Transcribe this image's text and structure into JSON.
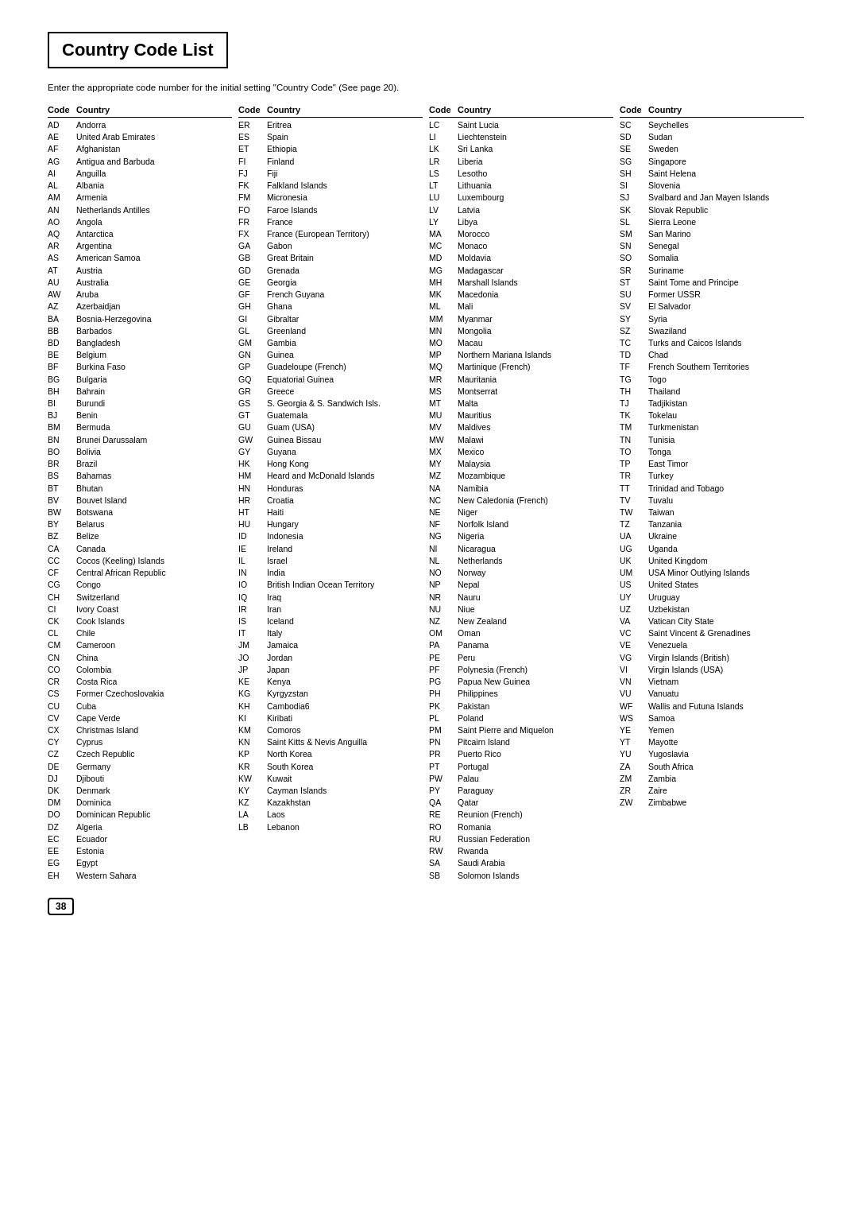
{
  "title": "Country Code List",
  "intro": "Enter the appropriate code number for the initial setting \"Country Code\" (See page 20).",
  "header": {
    "code": "Code",
    "country": "Country"
  },
  "page_number": "38",
  "columns": [
    {
      "entries": [
        {
          "code": "AD",
          "country": "Andorra"
        },
        {
          "code": "AE",
          "country": "United Arab Emirates"
        },
        {
          "code": "AF",
          "country": "Afghanistan"
        },
        {
          "code": "AG",
          "country": "Antigua and Barbuda"
        },
        {
          "code": "AI",
          "country": "Anguilla"
        },
        {
          "code": "AL",
          "country": "Albania"
        },
        {
          "code": "AM",
          "country": "Armenia"
        },
        {
          "code": "AN",
          "country": "Netherlands Antilles"
        },
        {
          "code": "AO",
          "country": "Angola"
        },
        {
          "code": "AQ",
          "country": "Antarctica"
        },
        {
          "code": "AR",
          "country": "Argentina"
        },
        {
          "code": "AS",
          "country": "American Samoa"
        },
        {
          "code": "AT",
          "country": "Austria"
        },
        {
          "code": "AU",
          "country": "Australia"
        },
        {
          "code": "AW",
          "country": "Aruba"
        },
        {
          "code": "AZ",
          "country": "Azerbaidjan"
        },
        {
          "code": "BA",
          "country": "Bosnia-Herzegovina"
        },
        {
          "code": "BB",
          "country": "Barbados"
        },
        {
          "code": "BD",
          "country": "Bangladesh"
        },
        {
          "code": "BE",
          "country": "Belgium"
        },
        {
          "code": "BF",
          "country": "Burkina Faso"
        },
        {
          "code": "BG",
          "country": "Bulgaria"
        },
        {
          "code": "BH",
          "country": "Bahrain"
        },
        {
          "code": "BI",
          "country": "Burundi"
        },
        {
          "code": "BJ",
          "country": "Benin"
        },
        {
          "code": "BM",
          "country": "Bermuda"
        },
        {
          "code": "BN",
          "country": "Brunei Darussalam"
        },
        {
          "code": "BO",
          "country": "Bolivia"
        },
        {
          "code": "BR",
          "country": "Brazil"
        },
        {
          "code": "BS",
          "country": "Bahamas"
        },
        {
          "code": "BT",
          "country": "Bhutan"
        },
        {
          "code": "BV",
          "country": "Bouvet Island"
        },
        {
          "code": "BW",
          "country": "Botswana"
        },
        {
          "code": "BY",
          "country": "Belarus"
        },
        {
          "code": "BZ",
          "country": "Belize"
        },
        {
          "code": "CA",
          "country": "Canada"
        },
        {
          "code": "CC",
          "country": "Cocos (Keeling) Islands"
        },
        {
          "code": "CF",
          "country": "Central African Republic"
        },
        {
          "code": "CG",
          "country": "Congo"
        },
        {
          "code": "CH",
          "country": "Switzerland"
        },
        {
          "code": "CI",
          "country": "Ivory Coast"
        },
        {
          "code": "CK",
          "country": "Cook Islands"
        },
        {
          "code": "CL",
          "country": "Chile"
        },
        {
          "code": "CM",
          "country": "Cameroon"
        },
        {
          "code": "CN",
          "country": "China"
        },
        {
          "code": "CO",
          "country": "Colombia"
        },
        {
          "code": "CR",
          "country": "Costa Rica"
        },
        {
          "code": "CS",
          "country": "Former Czechoslovakia"
        },
        {
          "code": "CU",
          "country": "Cuba"
        },
        {
          "code": "CV",
          "country": "Cape Verde"
        },
        {
          "code": "CX",
          "country": "Christmas Island"
        },
        {
          "code": "CY",
          "country": "Cyprus"
        },
        {
          "code": "CZ",
          "country": "Czech Republic"
        },
        {
          "code": "DE",
          "country": "Germany"
        },
        {
          "code": "DJ",
          "country": "Djibouti"
        },
        {
          "code": "DK",
          "country": "Denmark"
        },
        {
          "code": "DM",
          "country": "Dominica"
        },
        {
          "code": "DO",
          "country": "Dominican Republic"
        },
        {
          "code": "DZ",
          "country": "Algeria"
        },
        {
          "code": "EC",
          "country": "Ecuador"
        },
        {
          "code": "EE",
          "country": "Estonia"
        },
        {
          "code": "EG",
          "country": "Egypt"
        },
        {
          "code": "EH",
          "country": "Western Sahara"
        }
      ]
    },
    {
      "entries": [
        {
          "code": "ER",
          "country": "Eritrea"
        },
        {
          "code": "ES",
          "country": "Spain"
        },
        {
          "code": "ET",
          "country": "Ethiopia"
        },
        {
          "code": "FI",
          "country": "Finland"
        },
        {
          "code": "FJ",
          "country": "Fiji"
        },
        {
          "code": "FK",
          "country": "Falkland Islands"
        },
        {
          "code": "FM",
          "country": "Micronesia"
        },
        {
          "code": "FO",
          "country": "Faroe Islands"
        },
        {
          "code": "FR",
          "country": "France"
        },
        {
          "code": "FX",
          "country": "France (European Territory)"
        },
        {
          "code": "GA",
          "country": "Gabon"
        },
        {
          "code": "GB",
          "country": "Great Britain"
        },
        {
          "code": "GD",
          "country": "Grenada"
        },
        {
          "code": "GE",
          "country": "Georgia"
        },
        {
          "code": "GF",
          "country": "French Guyana"
        },
        {
          "code": "GH",
          "country": "Ghana"
        },
        {
          "code": "GI",
          "country": "Gibraltar"
        },
        {
          "code": "GL",
          "country": "Greenland"
        },
        {
          "code": "GM",
          "country": "Gambia"
        },
        {
          "code": "GN",
          "country": "Guinea"
        },
        {
          "code": "GP",
          "country": "Guadeloupe (French)"
        },
        {
          "code": "GQ",
          "country": "Equatorial Guinea"
        },
        {
          "code": "GR",
          "country": "Greece"
        },
        {
          "code": "GS",
          "country": "S. Georgia & S. Sandwich Isls."
        },
        {
          "code": "GT",
          "country": "Guatemala"
        },
        {
          "code": "GU",
          "country": "Guam (USA)"
        },
        {
          "code": "GW",
          "country": "Guinea Bissau"
        },
        {
          "code": "GY",
          "country": "Guyana"
        },
        {
          "code": "HK",
          "country": "Hong Kong"
        },
        {
          "code": "HM",
          "country": "Heard and McDonald Islands"
        },
        {
          "code": "HN",
          "country": "Honduras"
        },
        {
          "code": "HR",
          "country": "Croatia"
        },
        {
          "code": "HT",
          "country": "Haiti"
        },
        {
          "code": "HU",
          "country": "Hungary"
        },
        {
          "code": "ID",
          "country": "Indonesia"
        },
        {
          "code": "IE",
          "country": "Ireland"
        },
        {
          "code": "IL",
          "country": "Israel"
        },
        {
          "code": "IN",
          "country": "India"
        },
        {
          "code": "IO",
          "country": "British Indian Ocean Territory"
        },
        {
          "code": "IQ",
          "country": "Iraq"
        },
        {
          "code": "IR",
          "country": "Iran"
        },
        {
          "code": "IS",
          "country": "Iceland"
        },
        {
          "code": "IT",
          "country": "Italy"
        },
        {
          "code": "JM",
          "country": "Jamaica"
        },
        {
          "code": "JO",
          "country": "Jordan"
        },
        {
          "code": "JP",
          "country": "Japan"
        },
        {
          "code": "KE",
          "country": "Kenya"
        },
        {
          "code": "KG",
          "country": "Kyrgyzstan"
        },
        {
          "code": "KH",
          "country": "Cambodia6"
        },
        {
          "code": "KI",
          "country": "Kiribati"
        },
        {
          "code": "KM",
          "country": "Comoros"
        },
        {
          "code": "KN",
          "country": "Saint Kitts & Nevis Anguilla"
        },
        {
          "code": "KP",
          "country": "North Korea"
        },
        {
          "code": "KR",
          "country": "South Korea"
        },
        {
          "code": "KW",
          "country": "Kuwait"
        },
        {
          "code": "KY",
          "country": "Cayman Islands"
        },
        {
          "code": "KZ",
          "country": "Kazakhstan"
        },
        {
          "code": "LA",
          "country": "Laos"
        },
        {
          "code": "LB",
          "country": "Lebanon"
        }
      ]
    },
    {
      "entries": [
        {
          "code": "LC",
          "country": "Saint Lucia"
        },
        {
          "code": "LI",
          "country": "Liechtenstein"
        },
        {
          "code": "LK",
          "country": "Sri Lanka"
        },
        {
          "code": "LR",
          "country": "Liberia"
        },
        {
          "code": "LS",
          "country": "Lesotho"
        },
        {
          "code": "LT",
          "country": "Lithuania"
        },
        {
          "code": "LU",
          "country": "Luxembourg"
        },
        {
          "code": "LV",
          "country": "Latvia"
        },
        {
          "code": "LY",
          "country": "Libya"
        },
        {
          "code": "MA",
          "country": "Morocco"
        },
        {
          "code": "MC",
          "country": "Monaco"
        },
        {
          "code": "MD",
          "country": "Moldavia"
        },
        {
          "code": "MG",
          "country": "Madagascar"
        },
        {
          "code": "MH",
          "country": "Marshall Islands"
        },
        {
          "code": "MK",
          "country": "Macedonia"
        },
        {
          "code": "ML",
          "country": "Mali"
        },
        {
          "code": "MM",
          "country": "Myanmar"
        },
        {
          "code": "MN",
          "country": "Mongolia"
        },
        {
          "code": "MO",
          "country": "Macau"
        },
        {
          "code": "MP",
          "country": "Northern Mariana Islands"
        },
        {
          "code": "MQ",
          "country": "Martinique (French)"
        },
        {
          "code": "MR",
          "country": "Mauritania"
        },
        {
          "code": "MS",
          "country": "Montserrat"
        },
        {
          "code": "MT",
          "country": "Malta"
        },
        {
          "code": "MU",
          "country": "Mauritius"
        },
        {
          "code": "MV",
          "country": "Maldives"
        },
        {
          "code": "MW",
          "country": "Malawi"
        },
        {
          "code": "MX",
          "country": "Mexico"
        },
        {
          "code": "MY",
          "country": "Malaysia"
        },
        {
          "code": "MZ",
          "country": "Mozambique"
        },
        {
          "code": "NA",
          "country": "Namibia"
        },
        {
          "code": "NC",
          "country": "New Caledonia (French)"
        },
        {
          "code": "NE",
          "country": "Niger"
        },
        {
          "code": "NF",
          "country": "Norfolk Island"
        },
        {
          "code": "NG",
          "country": "Nigeria"
        },
        {
          "code": "NI",
          "country": "Nicaragua"
        },
        {
          "code": "NL",
          "country": "Netherlands"
        },
        {
          "code": "NO",
          "country": "Norway"
        },
        {
          "code": "NP",
          "country": "Nepal"
        },
        {
          "code": "NR",
          "country": "Nauru"
        },
        {
          "code": "NU",
          "country": "Niue"
        },
        {
          "code": "NZ",
          "country": "New Zealand"
        },
        {
          "code": "OM",
          "country": "Oman"
        },
        {
          "code": "PA",
          "country": "Panama"
        },
        {
          "code": "PE",
          "country": "Peru"
        },
        {
          "code": "PF",
          "country": "Polynesia (French)"
        },
        {
          "code": "PG",
          "country": "Papua New Guinea"
        },
        {
          "code": "PH",
          "country": "Philippines"
        },
        {
          "code": "PK",
          "country": "Pakistan"
        },
        {
          "code": "PL",
          "country": "Poland"
        },
        {
          "code": "PM",
          "country": "Saint Pierre and Miquelon"
        },
        {
          "code": "PN",
          "country": "Pitcairn Island"
        },
        {
          "code": "PR",
          "country": "Puerto Rico"
        },
        {
          "code": "PT",
          "country": "Portugal"
        },
        {
          "code": "PW",
          "country": "Palau"
        },
        {
          "code": "PY",
          "country": "Paraguay"
        },
        {
          "code": "QA",
          "country": "Qatar"
        },
        {
          "code": "RE",
          "country": "Reunion (French)"
        },
        {
          "code": "RO",
          "country": "Romania"
        },
        {
          "code": "RU",
          "country": "Russian Federation"
        },
        {
          "code": "RW",
          "country": "Rwanda"
        },
        {
          "code": "SA",
          "country": "Saudi Arabia"
        },
        {
          "code": "SB",
          "country": "Solomon Islands"
        }
      ]
    },
    {
      "entries": [
        {
          "code": "SC",
          "country": "Seychelles"
        },
        {
          "code": "SD",
          "country": "Sudan"
        },
        {
          "code": "SE",
          "country": "Sweden"
        },
        {
          "code": "SG",
          "country": "Singapore"
        },
        {
          "code": "SH",
          "country": "Saint Helena"
        },
        {
          "code": "SI",
          "country": "Slovenia"
        },
        {
          "code": "SJ",
          "country": "Svalbard and Jan Mayen Islands"
        },
        {
          "code": "SK",
          "country": "Slovak Republic"
        },
        {
          "code": "SL",
          "country": "Sierra Leone"
        },
        {
          "code": "SM",
          "country": "San Marino"
        },
        {
          "code": "SN",
          "country": "Senegal"
        },
        {
          "code": "SO",
          "country": "Somalia"
        },
        {
          "code": "SR",
          "country": "Suriname"
        },
        {
          "code": "ST",
          "country": "Saint Tome and Principe"
        },
        {
          "code": "SU",
          "country": "Former USSR"
        },
        {
          "code": "SV",
          "country": "El Salvador"
        },
        {
          "code": "SY",
          "country": "Syria"
        },
        {
          "code": "SZ",
          "country": "Swaziland"
        },
        {
          "code": "TC",
          "country": "Turks and Caicos Islands"
        },
        {
          "code": "TD",
          "country": "Chad"
        },
        {
          "code": "TF",
          "country": "French Southern Territories"
        },
        {
          "code": "TG",
          "country": "Togo"
        },
        {
          "code": "TH",
          "country": "Thailand"
        },
        {
          "code": "TJ",
          "country": "Tadjikistan"
        },
        {
          "code": "TK",
          "country": "Tokelau"
        },
        {
          "code": "TM",
          "country": "Turkmenistan"
        },
        {
          "code": "TN",
          "country": "Tunisia"
        },
        {
          "code": "TO",
          "country": "Tonga"
        },
        {
          "code": "TP",
          "country": "East Timor"
        },
        {
          "code": "TR",
          "country": "Turkey"
        },
        {
          "code": "TT",
          "country": "Trinidad and Tobago"
        },
        {
          "code": "TV",
          "country": "Tuvalu"
        },
        {
          "code": "TW",
          "country": "Taiwan"
        },
        {
          "code": "TZ",
          "country": "Tanzania"
        },
        {
          "code": "UA",
          "country": "Ukraine"
        },
        {
          "code": "UG",
          "country": "Uganda"
        },
        {
          "code": "UK",
          "country": "United Kingdom"
        },
        {
          "code": "UM",
          "country": "USA Minor Outlying Islands"
        },
        {
          "code": "US",
          "country": "United States"
        },
        {
          "code": "UY",
          "country": "Uruguay"
        },
        {
          "code": "UZ",
          "country": "Uzbekistan"
        },
        {
          "code": "VA",
          "country": "Vatican City State"
        },
        {
          "code": "VC",
          "country": "Saint Vincent & Grenadines"
        },
        {
          "code": "VE",
          "country": "Venezuela"
        },
        {
          "code": "VG",
          "country": "Virgin Islands (British)"
        },
        {
          "code": "VI",
          "country": "Virgin Islands (USA)"
        },
        {
          "code": "VN",
          "country": "Vietnam"
        },
        {
          "code": "VU",
          "country": "Vanuatu"
        },
        {
          "code": "WF",
          "country": "Wallis and Futuna Islands"
        },
        {
          "code": "WS",
          "country": "Samoa"
        },
        {
          "code": "YE",
          "country": "Yemen"
        },
        {
          "code": "YT",
          "country": "Mayotte"
        },
        {
          "code": "YU",
          "country": "Yugoslavia"
        },
        {
          "code": "ZA",
          "country": "South Africa"
        },
        {
          "code": "ZM",
          "country": "Zambia"
        },
        {
          "code": "ZR",
          "country": "Zaire"
        },
        {
          "code": "ZW",
          "country": "Zimbabwe"
        }
      ]
    }
  ]
}
